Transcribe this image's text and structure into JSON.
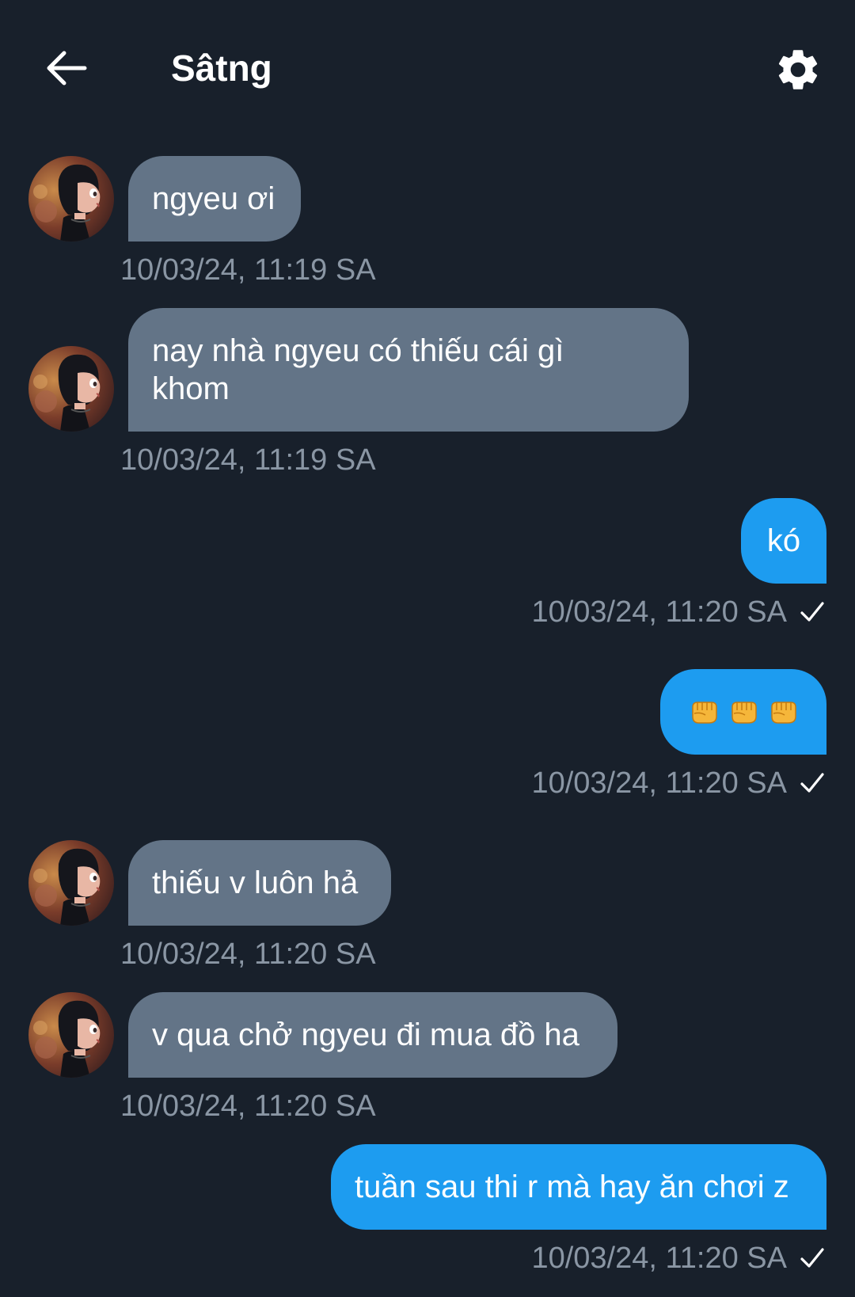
{
  "header": {
    "back_icon": "arrow-left-icon",
    "title": "Sâtng",
    "settings_icon": "gear-icon"
  },
  "messages": [
    {
      "direction": "incoming",
      "text": "ngyeu ơi",
      "timestamp": "10/03/24, 11:19 SA"
    },
    {
      "direction": "incoming",
      "text": "nay nhà ngyeu có thiếu cái gì khom",
      "line1": "nay nhà ngyeu có thiếu cái gì",
      "line2": "khom",
      "timestamp": "10/03/24, 11:19 SA"
    },
    {
      "direction": "outgoing",
      "text": "kó",
      "timestamp": "10/03/24, 11:20 SA",
      "status_icon": "checkmark-icon"
    },
    {
      "direction": "outgoing",
      "text": "👊👊👊",
      "emoji": [
        "oncoming-fist-icon",
        "oncoming-fist-icon",
        "oncoming-fist-icon"
      ],
      "timestamp": "10/03/24, 11:20 SA",
      "status_icon": "checkmark-icon"
    },
    {
      "direction": "incoming",
      "text": "thiếu v luôn hả",
      "timestamp": "10/03/24, 11:20 SA"
    },
    {
      "direction": "incoming",
      "text": "v qua chở ngyeu đi mua đồ ha",
      "timestamp": "10/03/24, 11:20 SA"
    },
    {
      "direction": "outgoing",
      "text": "tuần sau thi r mà hay ăn chơi z",
      "timestamp": "10/03/24, 11:20 SA",
      "status_icon": "checkmark-icon"
    }
  ],
  "colors": {
    "background": "#18202b",
    "incoming_bubble": "#637487",
    "outgoing_bubble": "#1d9cf0",
    "timestamp": "#8a96a4"
  }
}
